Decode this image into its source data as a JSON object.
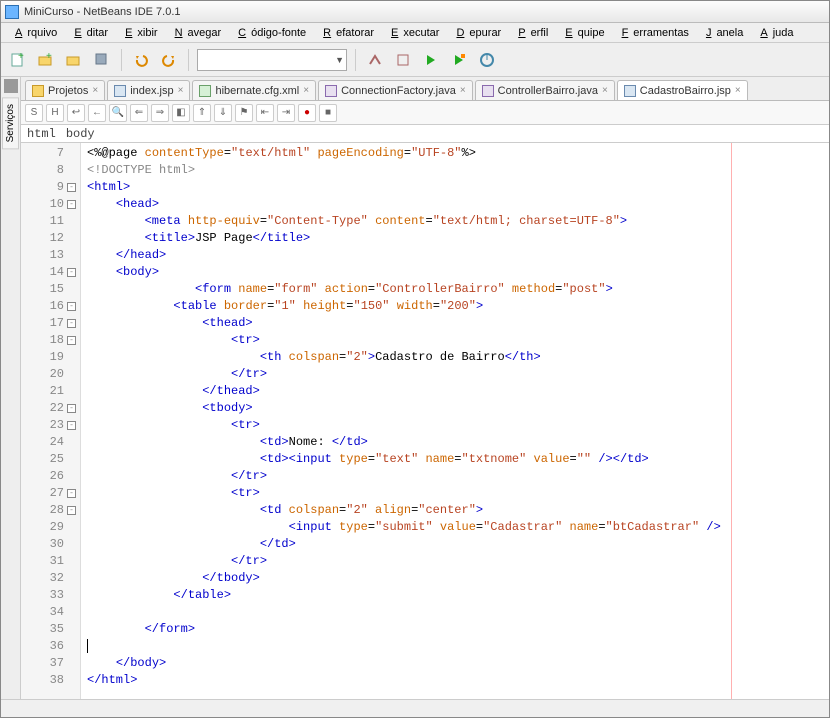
{
  "window": {
    "title": "MiniCurso - NetBeans IDE 7.0.1"
  },
  "menu": {
    "items": [
      "Arquivo",
      "Editar",
      "Exibir",
      "Navegar",
      "Código-fonte",
      "Refatorar",
      "Executar",
      "Depurar",
      "Perfil",
      "Equipe",
      "Ferramentas",
      "Janela",
      "Ajuda"
    ]
  },
  "sidebar": {
    "label": "Serviços"
  },
  "tabs": {
    "items": [
      {
        "label": "Projetos",
        "type": "folder"
      },
      {
        "label": "index.jsp",
        "type": "jsp"
      },
      {
        "label": "hibernate.cfg.xml",
        "type": "xml"
      },
      {
        "label": "ConnectionFactory.java",
        "type": "java"
      },
      {
        "label": "ControllerBairro.java",
        "type": "java"
      },
      {
        "label": "CadastroBairro.jsp",
        "type": "jsp",
        "active": true
      }
    ]
  },
  "breadcrumbs": [
    "html",
    "body"
  ],
  "editor": {
    "startLine": 7,
    "foldLines": [
      9,
      10,
      14,
      16,
      17,
      18,
      22,
      23,
      27,
      28
    ],
    "lines": [
      {
        "raw": [
          [
            "t-txt",
            "<%@page"
          ],
          [
            "t-attr",
            " contentType"
          ],
          [
            "t-txt",
            "="
          ],
          [
            "t-str",
            "\"text/html\""
          ],
          [
            "t-attr",
            " pageEncoding"
          ],
          [
            "t-txt",
            "="
          ],
          [
            "t-str",
            "\"UTF-8\""
          ],
          [
            "t-txt",
            "%>"
          ]
        ]
      },
      {
        "raw": [
          [
            "t-doctype",
            "<!DOCTYPE html>"
          ]
        ]
      },
      {
        "raw": [
          [
            "t-tag",
            "<html>"
          ]
        ]
      },
      {
        "raw": [
          [
            "t-txt",
            "    "
          ],
          [
            "t-tag",
            "<head>"
          ]
        ]
      },
      {
        "raw": [
          [
            "t-txt",
            "        "
          ],
          [
            "t-tag",
            "<meta"
          ],
          [
            "t-attr",
            " http-equiv"
          ],
          [
            "t-txt",
            "="
          ],
          [
            "t-str",
            "\"Content-Type\""
          ],
          [
            "t-attr",
            " content"
          ],
          [
            "t-txt",
            "="
          ],
          [
            "t-str",
            "\"text/html; charset=UTF-8\""
          ],
          [
            "t-tag",
            ">"
          ]
        ]
      },
      {
        "raw": [
          [
            "t-txt",
            "        "
          ],
          [
            "t-tag",
            "<title>"
          ],
          [
            "t-txt",
            "JSP Page"
          ],
          [
            "t-tag",
            "</title>"
          ]
        ]
      },
      {
        "raw": [
          [
            "t-txt",
            "    "
          ],
          [
            "t-tag",
            "</head>"
          ]
        ]
      },
      {
        "raw": [
          [
            "t-txt",
            "    "
          ],
          [
            "t-tag",
            "<body>"
          ]
        ]
      },
      {
        "raw": [
          [
            "t-txt",
            "               "
          ],
          [
            "t-tag",
            "<form"
          ],
          [
            "t-attr",
            " name"
          ],
          [
            "t-txt",
            "="
          ],
          [
            "t-str",
            "\"form\""
          ],
          [
            "t-attr",
            " action"
          ],
          [
            "t-txt",
            "="
          ],
          [
            "t-str",
            "\"ControllerBairro\""
          ],
          [
            "t-attr",
            " method"
          ],
          [
            "t-txt",
            "="
          ],
          [
            "t-str",
            "\"post\""
          ],
          [
            "t-tag",
            ">"
          ]
        ]
      },
      {
        "raw": [
          [
            "t-txt",
            "            "
          ],
          [
            "t-tag",
            "<table"
          ],
          [
            "t-attr",
            " border"
          ],
          [
            "t-txt",
            "="
          ],
          [
            "t-str",
            "\"1\""
          ],
          [
            "t-attr",
            " height"
          ],
          [
            "t-txt",
            "="
          ],
          [
            "t-str",
            "\"150\""
          ],
          [
            "t-attr",
            " width"
          ],
          [
            "t-txt",
            "="
          ],
          [
            "t-str",
            "\"200\""
          ],
          [
            "t-tag",
            ">"
          ]
        ]
      },
      {
        "raw": [
          [
            "t-txt",
            "                "
          ],
          [
            "t-tag",
            "<thead>"
          ]
        ]
      },
      {
        "raw": [
          [
            "t-txt",
            "                    "
          ],
          [
            "t-tag",
            "<tr>"
          ]
        ]
      },
      {
        "raw": [
          [
            "t-txt",
            "                        "
          ],
          [
            "t-tag",
            "<th"
          ],
          [
            "t-attr",
            " colspan"
          ],
          [
            "t-txt",
            "="
          ],
          [
            "t-str",
            "\"2\""
          ],
          [
            "t-tag",
            ">"
          ],
          [
            "t-txt",
            "Cadastro de Bairro"
          ],
          [
            "t-tag",
            "</th>"
          ]
        ]
      },
      {
        "raw": [
          [
            "t-txt",
            "                    "
          ],
          [
            "t-tag",
            "</tr>"
          ]
        ]
      },
      {
        "raw": [
          [
            "t-txt",
            "                "
          ],
          [
            "t-tag",
            "</thead>"
          ]
        ]
      },
      {
        "raw": [
          [
            "t-txt",
            "                "
          ],
          [
            "t-tag",
            "<tbody>"
          ]
        ]
      },
      {
        "raw": [
          [
            "t-txt",
            "                    "
          ],
          [
            "t-tag",
            "<tr>"
          ]
        ]
      },
      {
        "raw": [
          [
            "t-txt",
            "                        "
          ],
          [
            "t-tag",
            "<td>"
          ],
          [
            "t-txt",
            "Nome: "
          ],
          [
            "t-tag",
            "</td>"
          ]
        ]
      },
      {
        "raw": [
          [
            "t-txt",
            "                        "
          ],
          [
            "t-tag",
            "<td><input"
          ],
          [
            "t-attr",
            " type"
          ],
          [
            "t-txt",
            "="
          ],
          [
            "t-str",
            "\"text\""
          ],
          [
            "t-attr",
            " name"
          ],
          [
            "t-txt",
            "="
          ],
          [
            "t-str",
            "\"txtnome\""
          ],
          [
            "t-attr",
            " value"
          ],
          [
            "t-txt",
            "="
          ],
          [
            "t-str",
            "\"\""
          ],
          [
            "t-tag",
            " /></td>"
          ]
        ]
      },
      {
        "raw": [
          [
            "t-txt",
            "                    "
          ],
          [
            "t-tag",
            "</tr>"
          ]
        ]
      },
      {
        "raw": [
          [
            "t-txt",
            "                    "
          ],
          [
            "t-tag",
            "<tr>"
          ]
        ]
      },
      {
        "raw": [
          [
            "t-txt",
            "                        "
          ],
          [
            "t-tag",
            "<td"
          ],
          [
            "t-attr",
            " colspan"
          ],
          [
            "t-txt",
            "="
          ],
          [
            "t-str",
            "\"2\""
          ],
          [
            "t-attr",
            " align"
          ],
          [
            "t-txt",
            "="
          ],
          [
            "t-str",
            "\"center\""
          ],
          [
            "t-tag",
            ">"
          ]
        ]
      },
      {
        "raw": [
          [
            "t-txt",
            "                            "
          ],
          [
            "t-tag",
            "<input"
          ],
          [
            "t-attr",
            " type"
          ],
          [
            "t-txt",
            "="
          ],
          [
            "t-str",
            "\"submit\""
          ],
          [
            "t-attr",
            " value"
          ],
          [
            "t-txt",
            "="
          ],
          [
            "t-str",
            "\"Cadastrar\""
          ],
          [
            "t-attr",
            " name"
          ],
          [
            "t-txt",
            "="
          ],
          [
            "t-str",
            "\"btCadastrar\""
          ],
          [
            "t-tag",
            " />"
          ]
        ]
      },
      {
        "raw": [
          [
            "t-txt",
            "                        "
          ],
          [
            "t-tag",
            "</td>"
          ]
        ]
      },
      {
        "raw": [
          [
            "t-txt",
            "                    "
          ],
          [
            "t-tag",
            "</tr>"
          ]
        ]
      },
      {
        "raw": [
          [
            "t-txt",
            "                "
          ],
          [
            "t-tag",
            "</tbody>"
          ]
        ]
      },
      {
        "raw": [
          [
            "t-txt",
            "            "
          ],
          [
            "t-tag",
            "</table>"
          ]
        ]
      },
      {
        "raw": [
          [
            "t-txt",
            ""
          ]
        ]
      },
      {
        "raw": [
          [
            "t-txt",
            "        "
          ],
          [
            "t-tag",
            "</form>"
          ]
        ]
      },
      {
        "raw": [
          [
            "t-txt",
            ""
          ]
        ],
        "cursor": true
      },
      {
        "raw": [
          [
            "t-txt",
            "    "
          ],
          [
            "t-tag",
            "</body>"
          ]
        ]
      },
      {
        "raw": [
          [
            "t-tag",
            "</html>"
          ]
        ]
      }
    ]
  },
  "status": {
    "text": ""
  }
}
